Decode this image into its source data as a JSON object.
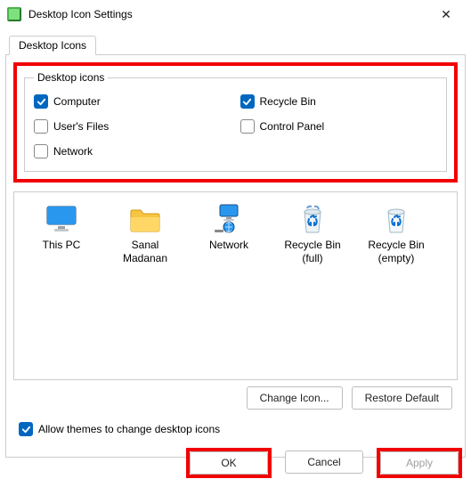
{
  "window": {
    "title": "Desktop Icon Settings",
    "close_glyph": "✕"
  },
  "tab": {
    "label": "Desktop Icons"
  },
  "group": {
    "legend": "Desktop icons",
    "items": [
      {
        "label": "Computer",
        "checked": true
      },
      {
        "label": "Recycle Bin",
        "checked": true
      },
      {
        "label": "User's Files",
        "checked": false
      },
      {
        "label": "Control Panel",
        "checked": false
      },
      {
        "label": "Network",
        "checked": false
      }
    ]
  },
  "preview": {
    "items": [
      {
        "label1": "This PC",
        "label2": ""
      },
      {
        "label1": "Sanal",
        "label2": "Madanan"
      },
      {
        "label1": "Network",
        "label2": ""
      },
      {
        "label1": "Recycle Bin",
        "label2": "(full)"
      },
      {
        "label1": "Recycle Bin",
        "label2": "(empty)"
      }
    ]
  },
  "buttons": {
    "change_icon": "Change Icon...",
    "restore_default": "Restore Default",
    "ok": "OK",
    "cancel": "Cancel",
    "apply": "Apply"
  },
  "themes": {
    "label": "Allow themes to change desktop icons",
    "checked": true
  }
}
